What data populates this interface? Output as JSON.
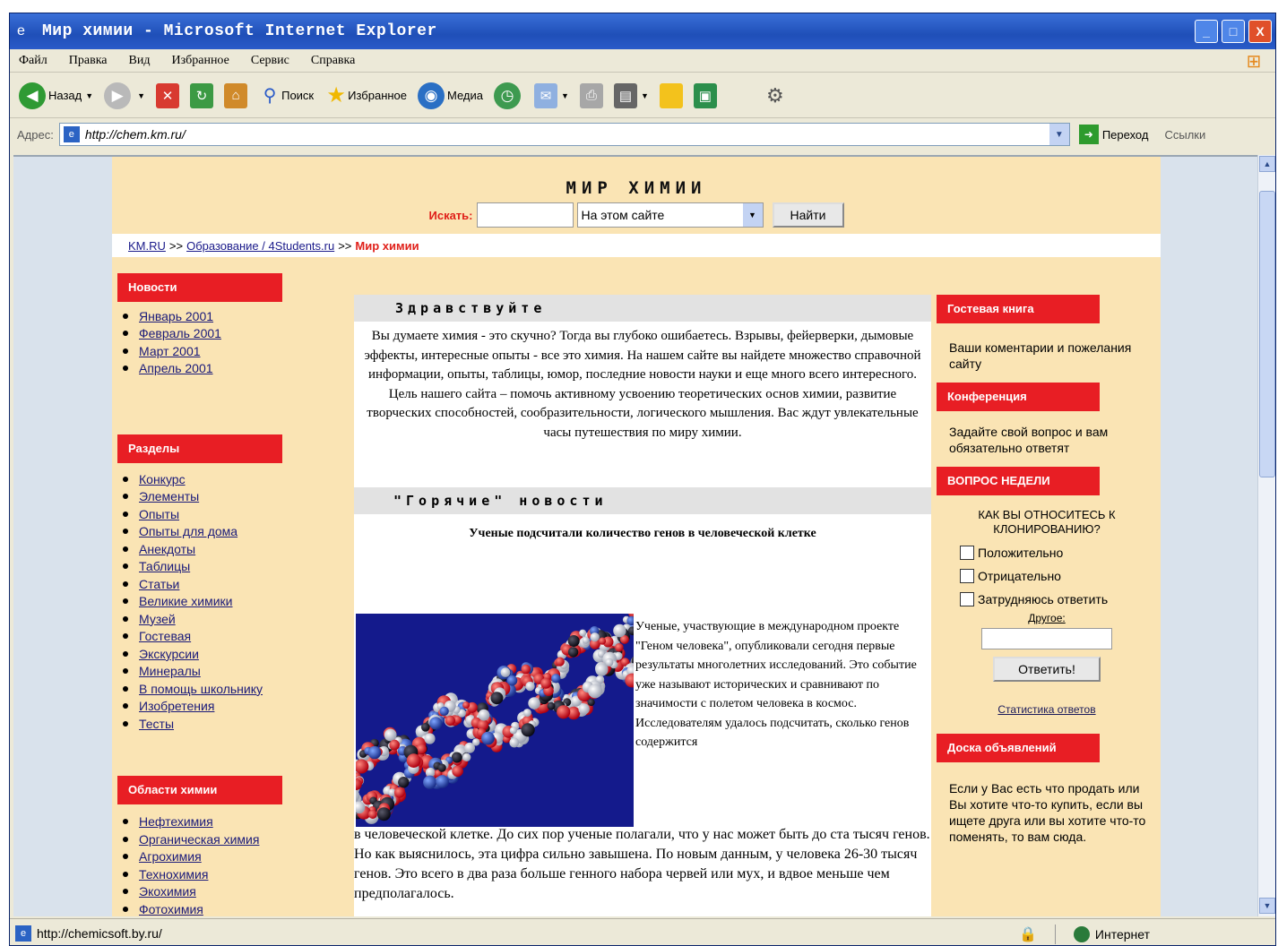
{
  "window": {
    "title": "Мир химии - Microsoft Internet Explorer",
    "controls": [
      "_",
      "□",
      "X"
    ]
  },
  "menu": [
    "Файл",
    "Правка",
    "Вид",
    "Избранное",
    "Сервис",
    "Справка"
  ],
  "toolbar": {
    "back": "Назад",
    "search": "Поиск",
    "favorites": "Избранное",
    "media": "Медиа"
  },
  "address": {
    "label": "Адрес:",
    "url": "http://chem.km.ru/",
    "go": "Переход",
    "links": "Ссылки"
  },
  "site": {
    "title": "МИР ХИМИИ",
    "search_label": "Искать:",
    "search_scope": "На этом сайте",
    "search_button": "Найти",
    "breadcrumb": [
      "KM.RU",
      "Образование / 4Students.ru",
      "Мир химии"
    ]
  },
  "left": {
    "news_header": "Новости",
    "news": [
      "Январь 2001",
      "Февраль 2001",
      "Март 2001",
      "Апрель 2001"
    ],
    "sections_header": "Разделы",
    "sections": [
      "Конкурс",
      "Элементы",
      "Опыты",
      "Опыты для дома",
      "Анекдоты",
      "Таблицы",
      "Статьи",
      "Великие химики",
      "Музей",
      "Гостевая",
      "Экскурсии",
      "Минералы",
      "В помощь школьнику",
      "Изобретения",
      "Тесты"
    ],
    "areas_header": "Области химии",
    "areas": [
      "Нефтехимия",
      "Органическая химия",
      "Агрохимия",
      "Технохимия",
      "Экохимия",
      "Фотохимия"
    ]
  },
  "center": {
    "welcome_header": "Здравствуйте",
    "intro": "Вы думаете химия - это скучно? Тогда вы глубоко ошибаетесь. Взрывы, фейерверки, дымовые эффекты, интересные опыты - все это химия. На нашем сайте вы найдете множество справочной информации, опыты, таблицы, юмор, последние новости науки и еще много всего интересного. Цель нашего сайта – помочь активному усвоению теоретических основ химии, развитие творческих способностей, сообразительности, логического мышления. Вас ждут увлекательные часы путешествия по миру химии.",
    "hot_header": "\"Горячие\" новости",
    "news_title": "Ученые подсчитали количество генов в человеческой клетке",
    "news_side": "Ученые, участвующие в международном проекте \"Геном человека\", опубликовали сегодня первые результаты многолетних исследований. Это событие уже называют исторических и сравнивают по значимости с полетом человека в космос. Исследователям удалось подсчитать, сколько генов содержится",
    "news_bottom": "в человеческой клетке. До сих пор ученые полагали, что у нас может быть до ста тысяч генов. Но как выяснилось, эта цифра сильно завышена. По новым данным, у человека 26-30 тысяч генов. Это всего в два раза больше генного набора червей или мух, и вдвое меньше чем предполагалось."
  },
  "right": {
    "guestbook_header": "Гостевая книга",
    "guestbook_text": "Ваши коментарии и пожелания сайту",
    "conference_header": "Конференция",
    "conference_text": "Задайте свой вопрос и вам обязательно ответят",
    "poll_header": "ВОПРОС НЕДЕЛИ",
    "poll_question": "КАК ВЫ ОТНОСИТЕСЬ К КЛОНИРОВАНИЮ?",
    "options": [
      "Положительно",
      "Отрицательно",
      "Затрудняюсь ответить"
    ],
    "other_label": "Другое:",
    "vote_button": "Ответить!",
    "results_link": "Статистика ответов",
    "board_header": "Доска объявлений",
    "board_text": "Если у Вас есть что продать или Вы хотите что-то купить, если вы ищете друга или вы хотите что-то поменять, то вам сюда."
  },
  "status": {
    "url": "http://chemicsoft.by.ru/",
    "zone": "Интернет"
  }
}
